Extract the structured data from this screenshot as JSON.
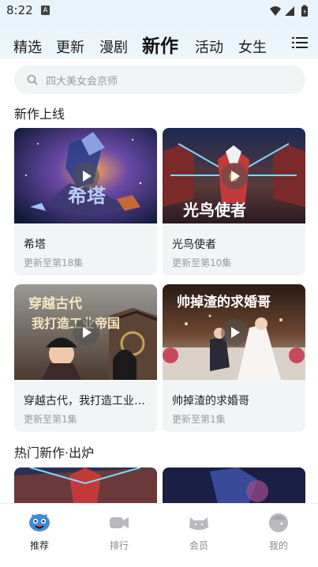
{
  "status_bar": {
    "time": "8:22",
    "app_badge": "A"
  },
  "header": {
    "tabs": [
      {
        "label": "精选"
      },
      {
        "label": "更新"
      },
      {
        "label": "漫剧"
      },
      {
        "label": "新作"
      },
      {
        "label": "活动"
      },
      {
        "label": "女生"
      }
    ],
    "active_tab": "新作"
  },
  "search": {
    "placeholder": "四大美女会京师"
  },
  "sections": {
    "new_online": {
      "title": "新作上线"
    },
    "hot_new": {
      "title": "热门新作·出炉"
    }
  },
  "cards": [
    {
      "title": "希塔",
      "subtitle": "更新至第18集",
      "cover_text": "希塔"
    },
    {
      "title": "光鸟使者",
      "subtitle": "更新至第10集",
      "cover_text": "光鸟使者"
    },
    {
      "title": "穿越古代，我打造工业帝国",
      "subtitle": "更新至第1集",
      "cover_text_1": "穿越古代",
      "cover_text_2": "我打造工业帝国"
    },
    {
      "title": "帅掉渣的求婚哥",
      "subtitle": "更新至第1集",
      "cover_text": "帅掉渣的求婚哥"
    }
  ],
  "bottom_nav": [
    {
      "label": "推荐",
      "icon": "smiley-mascot-icon"
    },
    {
      "label": "排行",
      "icon": "video-camera-icon"
    },
    {
      "label": "会员",
      "icon": "cat-face-icon"
    },
    {
      "label": "我的",
      "icon": "profile-face-icon"
    }
  ]
}
